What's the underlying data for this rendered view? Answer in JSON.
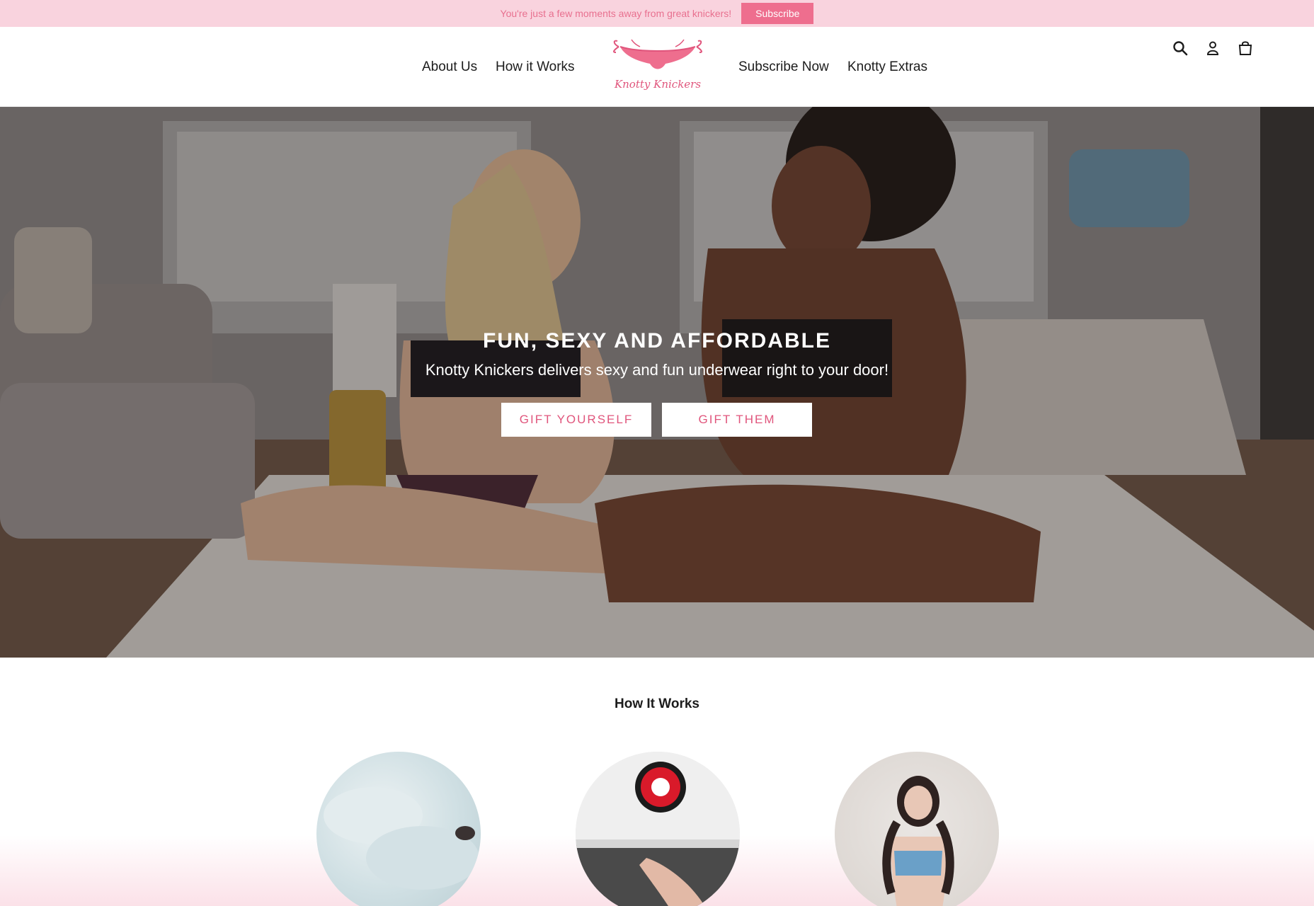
{
  "announcement": {
    "text": "You're just a few moments away from great knickers!",
    "button_label": "Subscribe"
  },
  "header": {
    "nav_left": [
      {
        "label": "About Us"
      },
      {
        "label": "How it Works"
      }
    ],
    "nav_right": [
      {
        "label": "Subscribe Now"
      },
      {
        "label": "Knotty Extras"
      }
    ],
    "logo_text": "Knotty Knickers",
    "icons": [
      "search-icon",
      "account-icon",
      "cart-icon"
    ]
  },
  "hero": {
    "title": "FUN, SEXY AND AFFORDABLE",
    "subtitle": "Knotty Knickers delivers sexy and fun underwear right to your door!",
    "buttons": [
      {
        "label": "GIFT YOURSELF"
      },
      {
        "label": "GIFT THEM"
      }
    ]
  },
  "how_it_works": {
    "title": "How It Works"
  },
  "colors": {
    "announce_bg": "#f9d3de",
    "brand_pink": "#ee6e8e",
    "logo_pink": "#e0557c"
  }
}
